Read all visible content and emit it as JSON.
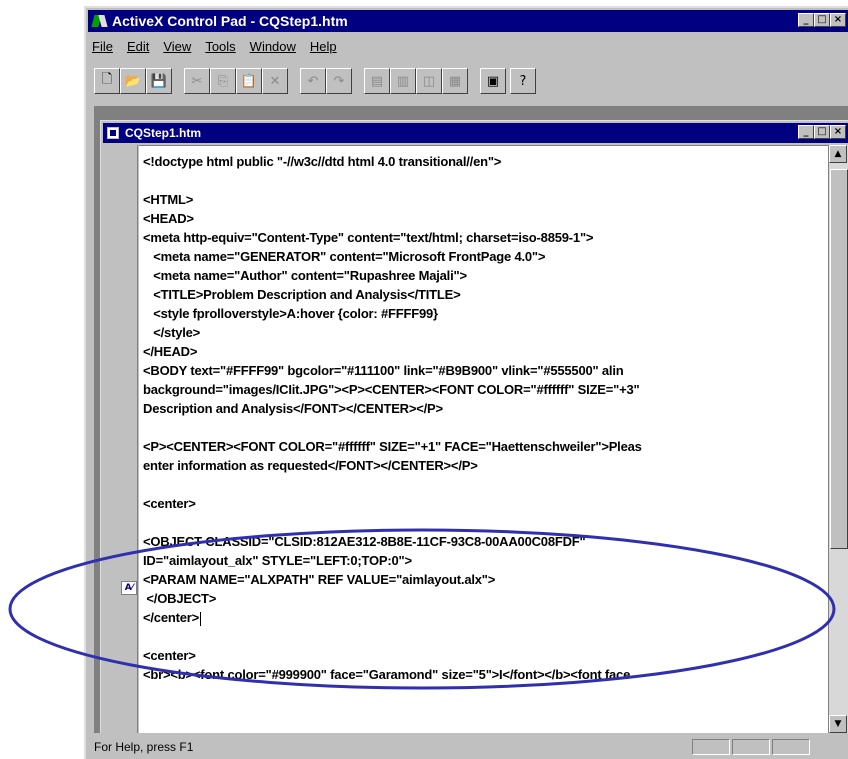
{
  "app": {
    "title": "ActiveX Control Pad - CQStep1.htm",
    "window_buttons": [
      "_",
      "□",
      "×"
    ]
  },
  "menu": [
    "File",
    "Edit",
    "View",
    "Tools",
    "Window",
    "Help"
  ],
  "toolbar": {
    "buttons": [
      {
        "name": "new-icon",
        "glyph": "🗋",
        "enabled": true
      },
      {
        "name": "open-icon",
        "glyph": "📂",
        "enabled": true
      },
      {
        "name": "save-icon",
        "glyph": "💾",
        "enabled": true
      },
      {
        "name": "cut-icon",
        "glyph": "✂",
        "enabled": false
      },
      {
        "name": "copy-icon",
        "glyph": "⎘",
        "enabled": false
      },
      {
        "name": "paste-icon",
        "glyph": "📋",
        "enabled": true
      },
      {
        "name": "delete-icon",
        "glyph": "✕",
        "enabled": false
      },
      {
        "name": "undo-icon",
        "glyph": "↶",
        "enabled": false
      },
      {
        "name": "redo-icon",
        "glyph": "↷",
        "enabled": false
      },
      {
        "name": "tile-horizontal-icon",
        "glyph": "▤",
        "enabled": false
      },
      {
        "name": "tile-vertical-icon",
        "glyph": "▥",
        "enabled": false
      },
      {
        "name": "cascade-icon",
        "glyph": "◫",
        "enabled": false
      },
      {
        "name": "arrange-icon",
        "glyph": "▦",
        "enabled": false
      },
      {
        "name": "script-wizard-icon",
        "glyph": "▣",
        "enabled": true
      },
      {
        "name": "help-icon",
        "glyph": "?",
        "enabled": true
      }
    ]
  },
  "document": {
    "title": "CQStep1.htm",
    "lines": [
      "<!doctype html public \"-//w3c//dtd html 4.0 transitional//en\">",
      "",
      "<HTML>",
      "<HEAD>",
      "<meta http-equiv=\"Content-Type\" content=\"text/html; charset=iso-8859-1\">",
      "   <meta name=\"GENERATOR\" content=\"Microsoft FrontPage 4.0\">",
      "   <meta name=\"Author\" content=\"Rupashree Majali\">",
      "   <TITLE>Problem Description and Analysis</TITLE>",
      "   <style fprolloverstyle>A:hover {color: #FFFF99}",
      "   </style>",
      "</HEAD>",
      "<BODY text=\"#FFFF99\" bgcolor=\"#111100\" link=\"#B9B900\" vlink=\"#555500\" alin",
      "background=\"images/ICIit.JPG\"><P><CENTER><FONT COLOR=\"#ffffff\" SIZE=\"+3\"",
      "Description and Analysis</FONT></CENTER></P>",
      "",
      "<P><CENTER><FONT COLOR=\"#ffffff\" SIZE=\"+1\" FACE=\"Haettenschweiler\">Pleas",
      "enter information as requested</FONT></CENTER></P>",
      "",
      "<center>",
      "",
      "<OBJECT CLASSID=\"CLSID:812AE312-8B8E-11CF-93C8-00AA00C08FDF\"",
      "ID=\"aimlayout_alx\" STYLE=\"LEFT:0;TOP:0\">",
      "<PARAM NAME=\"ALXPATH\" REF VALUE=\"aimlayout.alx\">",
      " </OBJECT>",
      "</center>",
      "",
      "<center>",
      "<br><b><font color=\"#999900\" face=\"Garamond\" size=\"5\">I</font></b><font face"
    ],
    "activex_marker": "A⁄"
  },
  "statusbar": {
    "text": "For Help, press F1"
  }
}
